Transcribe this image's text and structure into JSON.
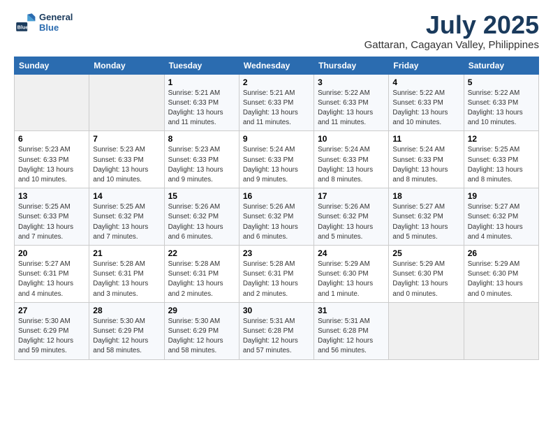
{
  "header": {
    "logo_line1": "General",
    "logo_line2": "Blue",
    "month": "July 2025",
    "location": "Gattaran, Cagayan Valley, Philippines"
  },
  "weekdays": [
    "Sunday",
    "Monday",
    "Tuesday",
    "Wednesday",
    "Thursday",
    "Friday",
    "Saturday"
  ],
  "weeks": [
    [
      {
        "day": "",
        "info": ""
      },
      {
        "day": "",
        "info": ""
      },
      {
        "day": "1",
        "info": "Sunrise: 5:21 AM\nSunset: 6:33 PM\nDaylight: 13 hours\nand 11 minutes."
      },
      {
        "day": "2",
        "info": "Sunrise: 5:21 AM\nSunset: 6:33 PM\nDaylight: 13 hours\nand 11 minutes."
      },
      {
        "day": "3",
        "info": "Sunrise: 5:22 AM\nSunset: 6:33 PM\nDaylight: 13 hours\nand 11 minutes."
      },
      {
        "day": "4",
        "info": "Sunrise: 5:22 AM\nSunset: 6:33 PM\nDaylight: 13 hours\nand 10 minutes."
      },
      {
        "day": "5",
        "info": "Sunrise: 5:22 AM\nSunset: 6:33 PM\nDaylight: 13 hours\nand 10 minutes."
      }
    ],
    [
      {
        "day": "6",
        "info": "Sunrise: 5:23 AM\nSunset: 6:33 PM\nDaylight: 13 hours\nand 10 minutes."
      },
      {
        "day": "7",
        "info": "Sunrise: 5:23 AM\nSunset: 6:33 PM\nDaylight: 13 hours\nand 10 minutes."
      },
      {
        "day": "8",
        "info": "Sunrise: 5:23 AM\nSunset: 6:33 PM\nDaylight: 13 hours\nand 9 minutes."
      },
      {
        "day": "9",
        "info": "Sunrise: 5:24 AM\nSunset: 6:33 PM\nDaylight: 13 hours\nand 9 minutes."
      },
      {
        "day": "10",
        "info": "Sunrise: 5:24 AM\nSunset: 6:33 PM\nDaylight: 13 hours\nand 8 minutes."
      },
      {
        "day": "11",
        "info": "Sunrise: 5:24 AM\nSunset: 6:33 PM\nDaylight: 13 hours\nand 8 minutes."
      },
      {
        "day": "12",
        "info": "Sunrise: 5:25 AM\nSunset: 6:33 PM\nDaylight: 13 hours\nand 8 minutes."
      }
    ],
    [
      {
        "day": "13",
        "info": "Sunrise: 5:25 AM\nSunset: 6:33 PM\nDaylight: 13 hours\nand 7 minutes."
      },
      {
        "day": "14",
        "info": "Sunrise: 5:25 AM\nSunset: 6:32 PM\nDaylight: 13 hours\nand 7 minutes."
      },
      {
        "day": "15",
        "info": "Sunrise: 5:26 AM\nSunset: 6:32 PM\nDaylight: 13 hours\nand 6 minutes."
      },
      {
        "day": "16",
        "info": "Sunrise: 5:26 AM\nSunset: 6:32 PM\nDaylight: 13 hours\nand 6 minutes."
      },
      {
        "day": "17",
        "info": "Sunrise: 5:26 AM\nSunset: 6:32 PM\nDaylight: 13 hours\nand 5 minutes."
      },
      {
        "day": "18",
        "info": "Sunrise: 5:27 AM\nSunset: 6:32 PM\nDaylight: 13 hours\nand 5 minutes."
      },
      {
        "day": "19",
        "info": "Sunrise: 5:27 AM\nSunset: 6:32 PM\nDaylight: 13 hours\nand 4 minutes."
      }
    ],
    [
      {
        "day": "20",
        "info": "Sunrise: 5:27 AM\nSunset: 6:31 PM\nDaylight: 13 hours\nand 4 minutes."
      },
      {
        "day": "21",
        "info": "Sunrise: 5:28 AM\nSunset: 6:31 PM\nDaylight: 13 hours\nand 3 minutes."
      },
      {
        "day": "22",
        "info": "Sunrise: 5:28 AM\nSunset: 6:31 PM\nDaylight: 13 hours\nand 2 minutes."
      },
      {
        "day": "23",
        "info": "Sunrise: 5:28 AM\nSunset: 6:31 PM\nDaylight: 13 hours\nand 2 minutes."
      },
      {
        "day": "24",
        "info": "Sunrise: 5:29 AM\nSunset: 6:30 PM\nDaylight: 13 hours\nand 1 minute."
      },
      {
        "day": "25",
        "info": "Sunrise: 5:29 AM\nSunset: 6:30 PM\nDaylight: 13 hours\nand 0 minutes."
      },
      {
        "day": "26",
        "info": "Sunrise: 5:29 AM\nSunset: 6:30 PM\nDaylight: 13 hours\nand 0 minutes."
      }
    ],
    [
      {
        "day": "27",
        "info": "Sunrise: 5:30 AM\nSunset: 6:29 PM\nDaylight: 12 hours\nand 59 minutes."
      },
      {
        "day": "28",
        "info": "Sunrise: 5:30 AM\nSunset: 6:29 PM\nDaylight: 12 hours\nand 58 minutes."
      },
      {
        "day": "29",
        "info": "Sunrise: 5:30 AM\nSunset: 6:29 PM\nDaylight: 12 hours\nand 58 minutes."
      },
      {
        "day": "30",
        "info": "Sunrise: 5:31 AM\nSunset: 6:28 PM\nDaylight: 12 hours\nand 57 minutes."
      },
      {
        "day": "31",
        "info": "Sunrise: 5:31 AM\nSunset: 6:28 PM\nDaylight: 12 hours\nand 56 minutes."
      },
      {
        "day": "",
        "info": ""
      },
      {
        "day": "",
        "info": ""
      }
    ]
  ]
}
